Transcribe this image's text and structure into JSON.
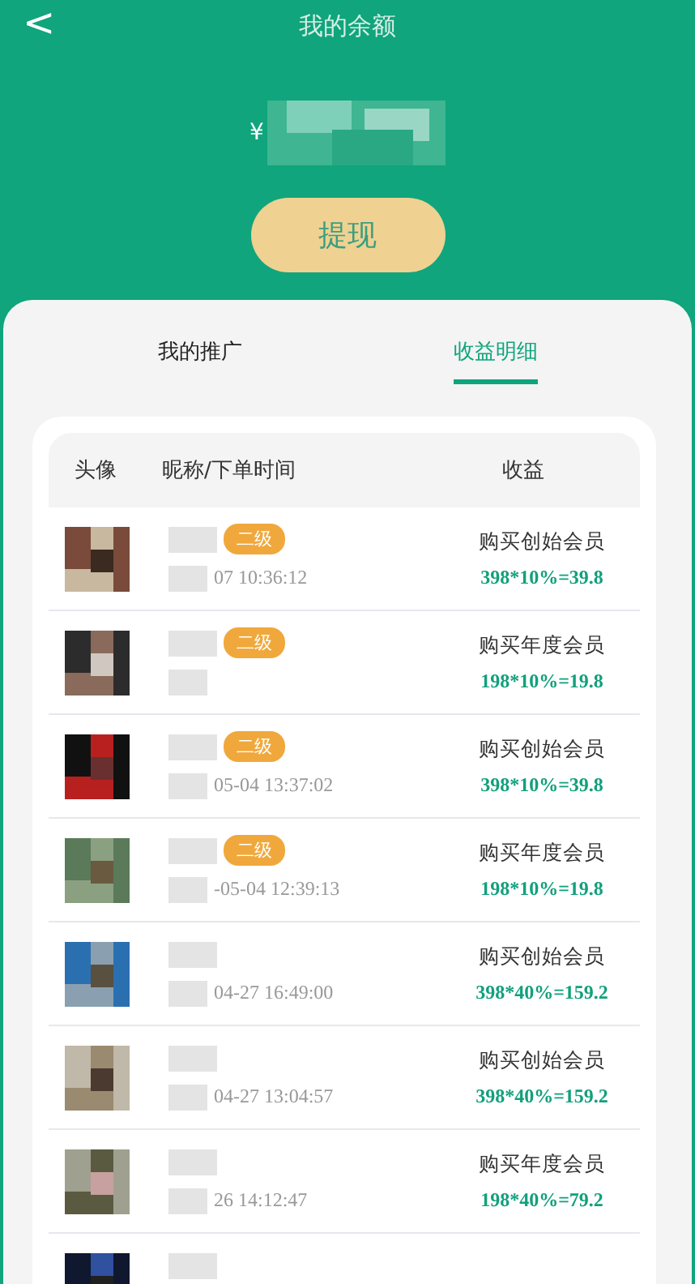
{
  "header": {
    "back": "<",
    "title": "我的余额"
  },
  "balance": {
    "currency": "¥"
  },
  "withdraw_button": "提现",
  "tabs": [
    {
      "label": "我的推广",
      "selected": false
    },
    {
      "label": "收益明细",
      "selected": true
    }
  ],
  "table": {
    "columns": [
      "头像",
      "昵称/下单时间",
      "收益"
    ],
    "rows": [
      {
        "badge": "二级",
        "time": "07 10:36:12",
        "title": "购买创始会员",
        "calc": "398*10%=39.8"
      },
      {
        "badge": "二级",
        "title": "购买年度会员",
        "calc": "198*10%=19.8"
      },
      {
        "badge": "二级",
        "time": "05-04 13:37:02",
        "title": "购买创始会员",
        "calc": "398*10%=39.8"
      },
      {
        "badge": "二级",
        "time": "-05-04 12:39:13",
        "title": "购买年度会员",
        "calc": "198*10%=19.8"
      },
      {
        "time": "04-27 16:49:00",
        "title": "购买创始会员",
        "calc": "398*40%=159.2"
      },
      {
        "time": "04-27 13:04:57",
        "title": "购买创始会员",
        "calc": "398*40%=159.2"
      },
      {
        "time": "26 14:12:47",
        "title": "购买年度会员",
        "calc": "198*40%=79.2"
      },
      {}
    ]
  }
}
